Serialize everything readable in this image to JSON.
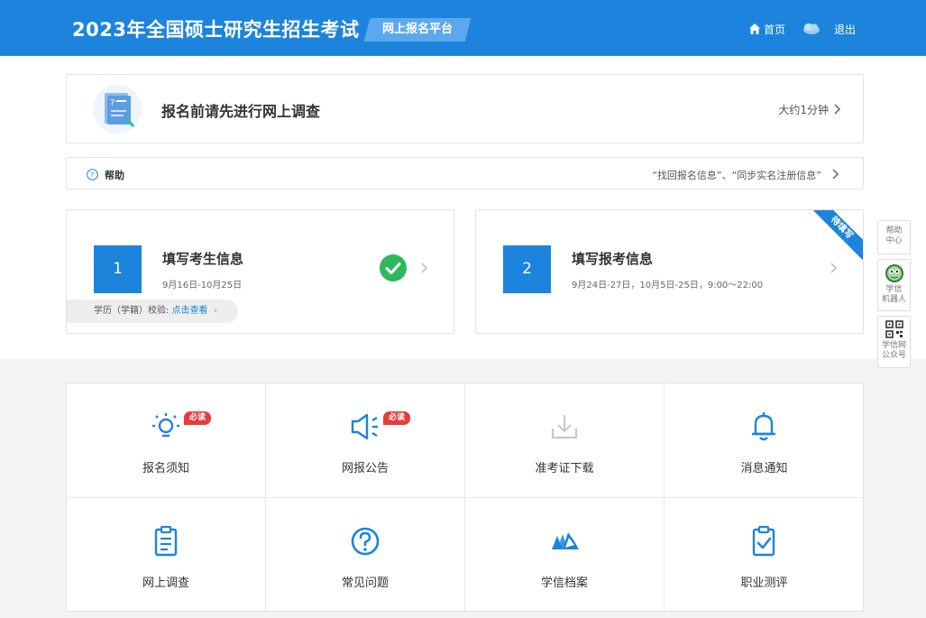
{
  "header": {
    "title": "2023年全国硕士研究生招生考试",
    "platform": "网上报名平台",
    "home_label": "首页",
    "logout_label": "退出"
  },
  "survey": {
    "text": "报名前请先进行网上调查",
    "duration": "大约1分钟"
  },
  "help": {
    "label": "帮助",
    "links": "“找回报名信息”、“同步实名注册信息”"
  },
  "steps": [
    {
      "number": "1",
      "title": "填写考生信息",
      "date": "9月16日-10月25日",
      "status": "completed",
      "verify_label": "学历（学籍）校验:",
      "verify_link": "点击查看"
    },
    {
      "number": "2",
      "title": "填写报考信息",
      "date": "9月24日-27日，10月5日-25日，9:00～22:00",
      "ribbon": "待填写"
    }
  ],
  "side_panel": [
    {
      "label_line1": "帮助",
      "label_line2": "中心",
      "icon": "none"
    },
    {
      "label_line1": "学信",
      "label_line2": "机器人",
      "icon": "robot-icon"
    },
    {
      "label_line1": "学信网",
      "label_line2": "公众号",
      "icon": "qr-code-icon"
    }
  ],
  "grid": [
    {
      "label": "报名须知",
      "icon": "lightbulb-icon",
      "badge": "必读"
    },
    {
      "label": "网报公告",
      "icon": "speaker-icon",
      "badge": "必读"
    },
    {
      "label": "准考证下载",
      "icon": "download-icon",
      "disabled": true
    },
    {
      "label": "消息通知",
      "icon": "bell-icon"
    },
    {
      "label": "网上调查",
      "icon": "clipboard-icon"
    },
    {
      "label": "常见问题",
      "icon": "question-icon"
    },
    {
      "label": "学信档案",
      "icon": "archive-icon"
    },
    {
      "label": "职业测评",
      "icon": "checklist-icon"
    }
  ],
  "colors": {
    "primary": "#1c84dc",
    "success": "#2eb85c",
    "badge": "#e43d3d",
    "disabled_icon": "#c8c8c8"
  }
}
